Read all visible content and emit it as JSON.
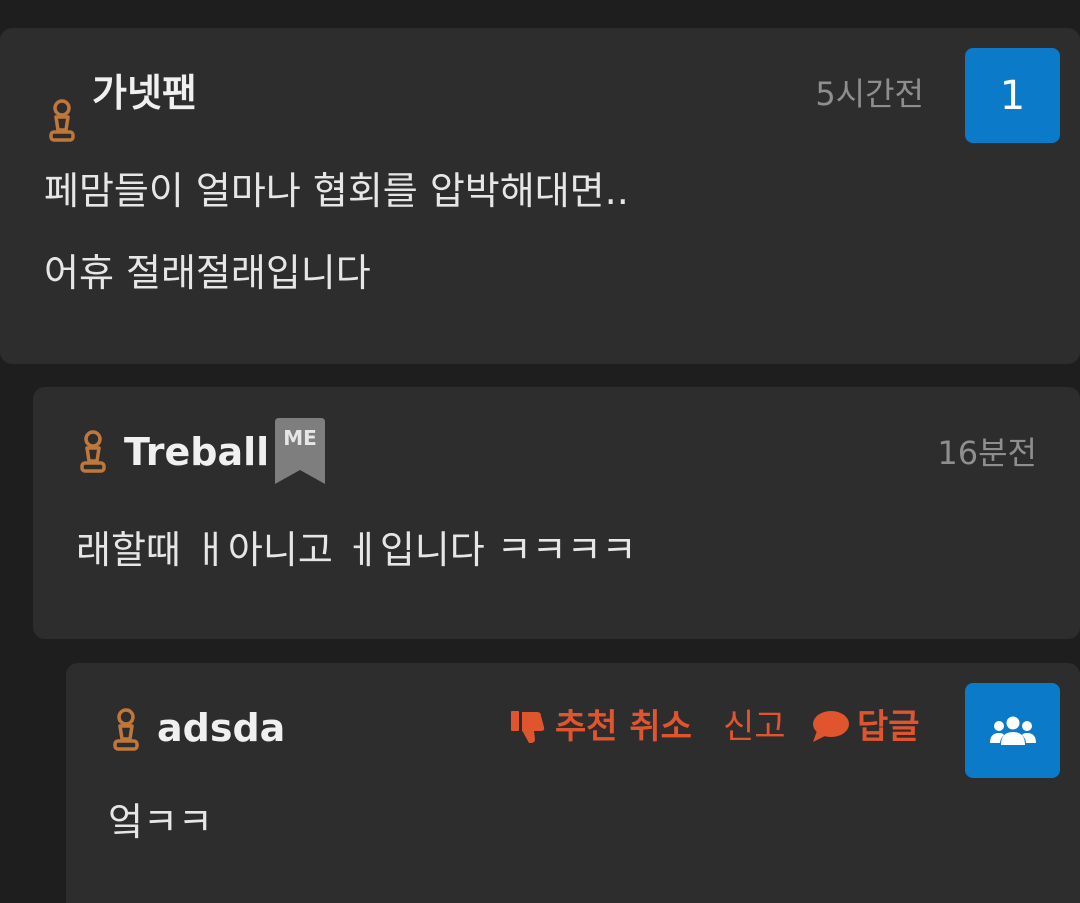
{
  "comments": [
    {
      "username": "가넷팬",
      "time": "5시간전",
      "lines": [
        "페맘들이 얼마나 협회를 압박해대면..",
        "어휴 절래절래입니다"
      ],
      "badge_count": "1"
    },
    {
      "username": "Treball",
      "tag": "ME",
      "time": "16분전",
      "lines": [
        "래할때 ㅐ아니고 ㅔ입니다 ㅋㅋㅋㅋ"
      ]
    },
    {
      "username": "adsda",
      "actions": {
        "unrecommend": "추천 취소",
        "report": "신고",
        "reply": "답글"
      },
      "lines": [
        "엌ㅋㅋ"
      ]
    }
  ],
  "colors": {
    "background": "#1e1e1f",
    "card": "#2d2d2e",
    "accent_blue": "#0a7ac9",
    "action_orange": "#e0552e",
    "rank_bronze": "#c0783a"
  }
}
